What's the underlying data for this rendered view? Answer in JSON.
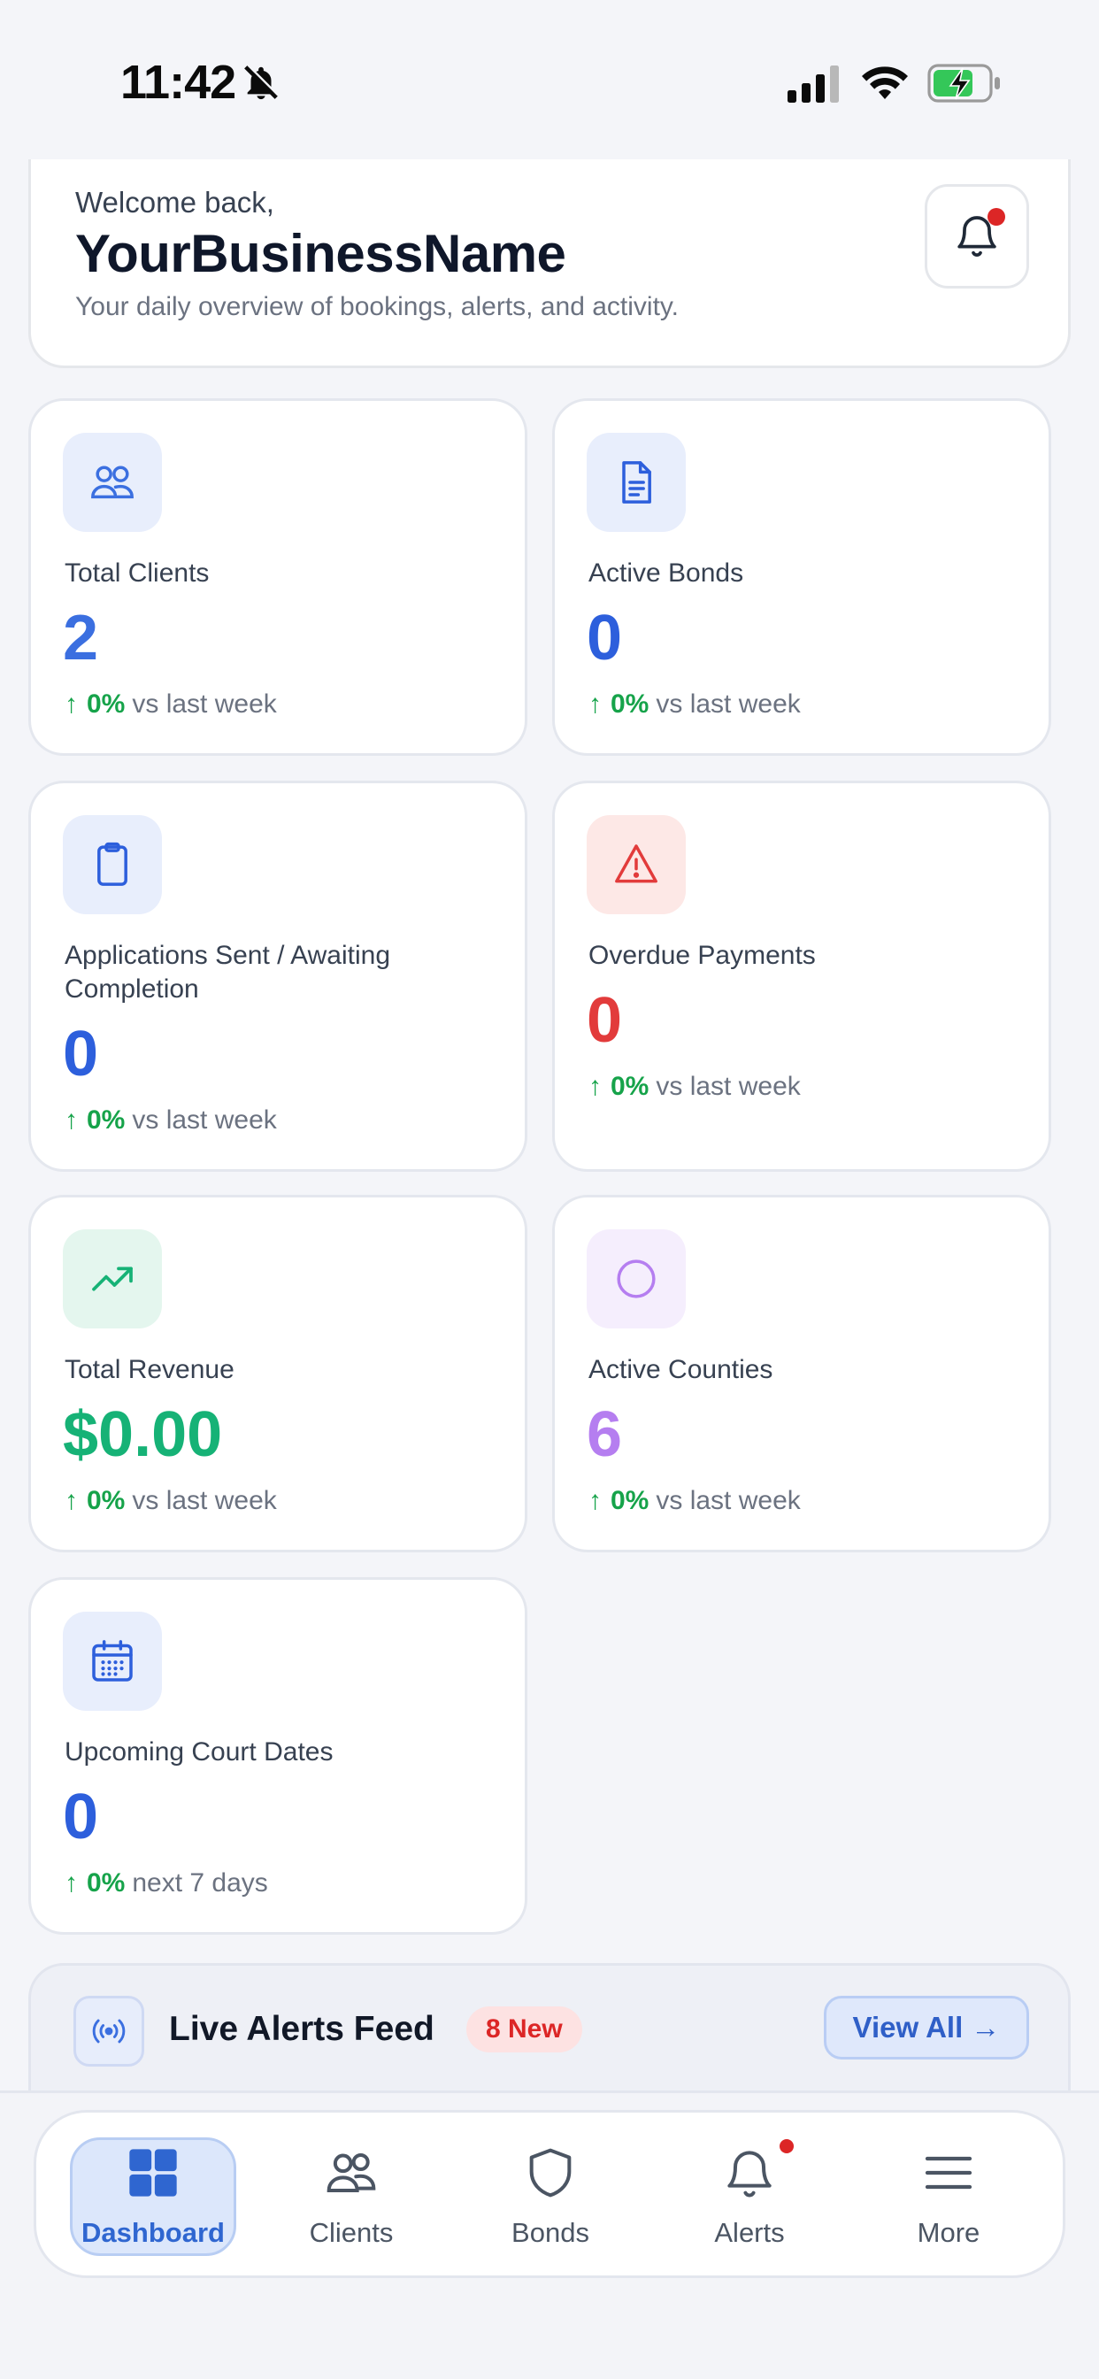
{
  "status_bar": {
    "time": "11:42"
  },
  "header": {
    "greeting": "Welcome back,",
    "business_name": "YourBusinessName",
    "subtitle": "Your daily overview of bookings, alerts, and activity."
  },
  "stats": [
    {
      "label": "Total Clients",
      "value": "2",
      "trend_pct": "0%",
      "trend_text": "vs last week",
      "icon": "users-icon",
      "color": "#3b6fe0"
    },
    {
      "label": "Active Bonds",
      "value": "0",
      "trend_pct": "0%",
      "trend_text": "vs last week",
      "icon": "document-icon",
      "color": "#2d5fdc"
    },
    {
      "label": "Applications Sent / Awaiting Completion",
      "value": "0",
      "trend_pct": "0%",
      "trend_text": "vs last week",
      "icon": "clipboard-icon",
      "color": "#2d5fdc"
    },
    {
      "label": "Overdue Payments",
      "value": "0",
      "trend_pct": "0%",
      "trend_text": "vs last week",
      "icon": "warning-icon",
      "color": "#e23b3b"
    },
    {
      "label": "Total Revenue",
      "value": "$0.00",
      "trend_pct": "0%",
      "trend_text": "vs last week",
      "icon": "trending-up-icon",
      "color": "#16b276"
    },
    {
      "label": "Active Counties",
      "value": "6",
      "trend_pct": "0%",
      "trend_text": "vs last week",
      "icon": "circle-icon",
      "color": "#b57ef0"
    },
    {
      "label": "Upcoming Court Dates",
      "value": "0",
      "trend_pct": "0%",
      "trend_text": "next 7 days",
      "icon": "calendar-icon",
      "color": "#2d5fdc"
    }
  ],
  "alerts_feed": {
    "title": "Live Alerts Feed",
    "badge": "8 New",
    "view_all": "View All →"
  },
  "nav": {
    "items": [
      {
        "label": "Dashboard",
        "icon": "grid-icon",
        "active": true
      },
      {
        "label": "Clients",
        "icon": "users-icon"
      },
      {
        "label": "Bonds",
        "icon": "shield-icon"
      },
      {
        "label": "Alerts",
        "icon": "bell-icon",
        "has_dot": true
      },
      {
        "label": "More",
        "icon": "menu-icon"
      }
    ]
  },
  "colors": {
    "accent_blue": "#2d5fdc",
    "danger_red": "#e23b3b",
    "success_green": "#16a34a",
    "purple": "#b57ef0"
  }
}
